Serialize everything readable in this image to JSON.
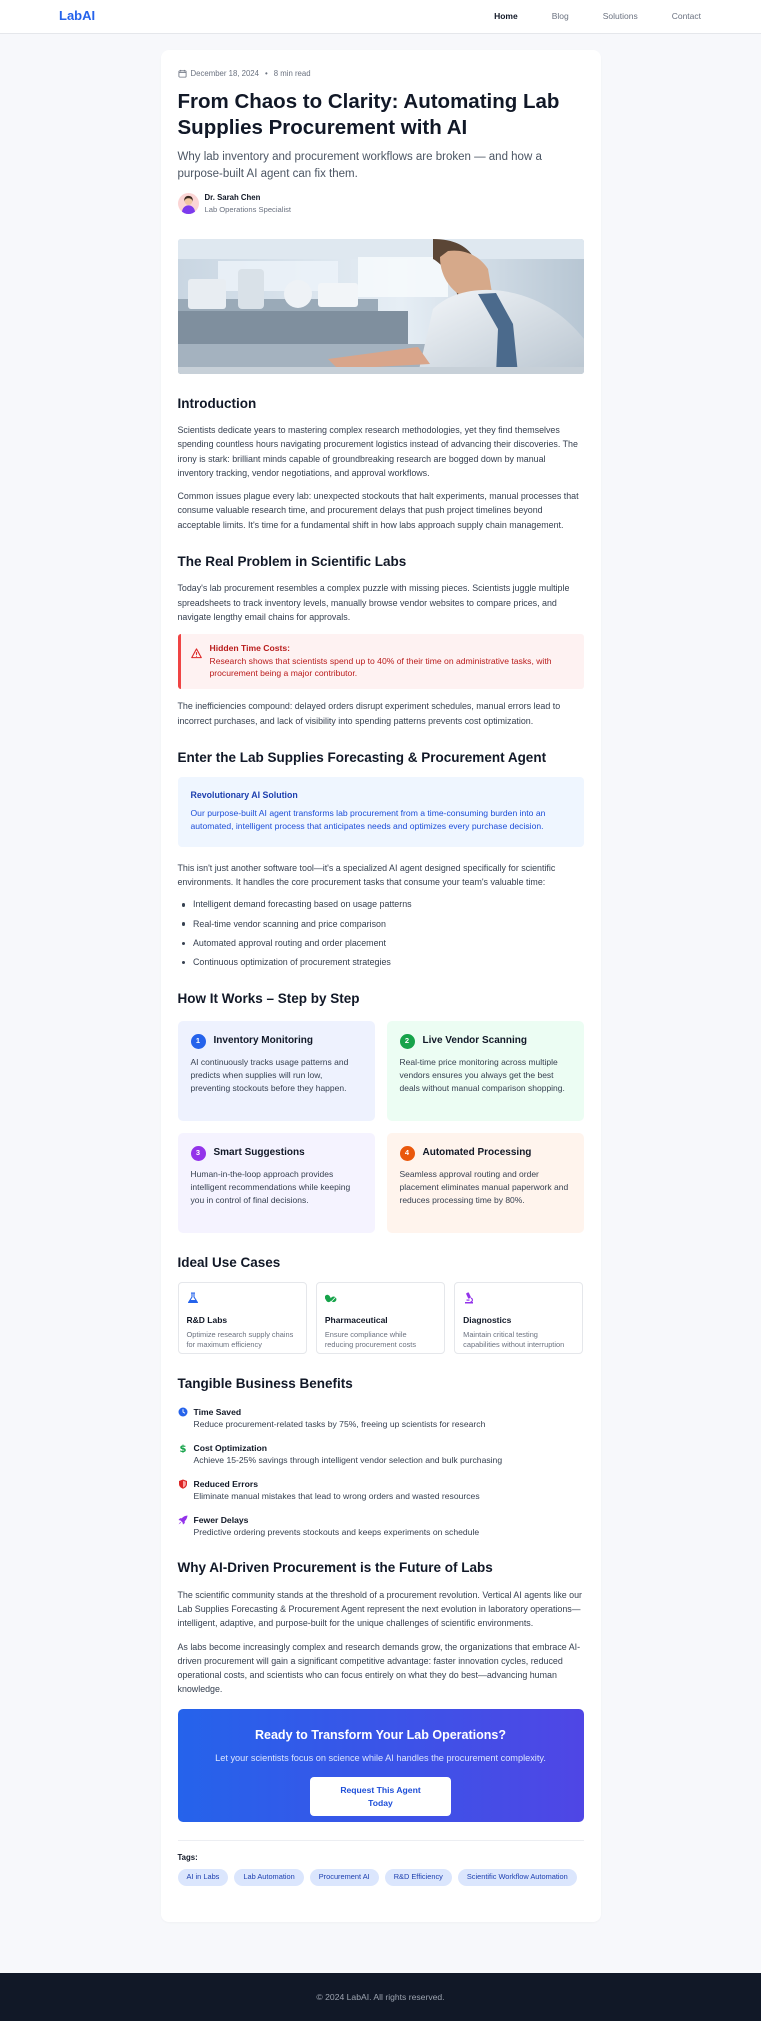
{
  "nav": {
    "brand": "LabAI",
    "links": [
      "Home",
      "Blog",
      "Solutions",
      "Contact"
    ]
  },
  "article": {
    "date": "December 18, 2024",
    "read_time": "8 min read",
    "title": "From Chaos to Clarity: Automating Lab Supplies Procurement with AI",
    "subtitle": "Why lab inventory and procurement workflows are broken — and how a purpose-built AI agent can fix them.",
    "author_name": "Dr. Sarah Chen",
    "author_role": "Lab Operations Specialist"
  },
  "intro": {
    "heading": "Introduction",
    "p1": "Scientists dedicate years to mastering complex research methodologies, yet they find themselves spending countless hours navigating procurement logistics instead of advancing their discoveries. The irony is stark: brilliant minds capable of groundbreaking research are bogged down by manual inventory tracking, vendor negotiations, and approval workflows.",
    "p2": "Common issues plague every lab: unexpected stockouts that halt experiments, manual processes that consume valuable research time, and procurement delays that push project timelines beyond acceptable limits. It's time for a fundamental shift in how labs approach supply chain management."
  },
  "problem": {
    "heading": "The Real Problem in Scientific Labs",
    "p1": "Today's lab procurement resembles a complex puzzle with missing pieces. Scientists juggle multiple spreadsheets to track inventory levels, manually browse vendor websites to compare prices, and navigate lengthy email chains for approvals.",
    "callout_title": "Hidden Time Costs:",
    "callout_body": "Research shows that scientists spend up to 40% of their time on administrative tasks, with procurement being a major contributor.",
    "p2": "The inefficiencies compound: delayed orders disrupt experiment schedules, manual errors lead to incorrect purchases, and lack of visibility into spending patterns prevents cost optimization."
  },
  "agent": {
    "heading": "Enter the Lab Supplies Forecasting & Procurement Agent",
    "callout_title": "Revolutionary AI Solution",
    "callout_body": "Our purpose-built AI agent transforms lab procurement from a time-consuming burden into an automated, intelligent process that anticipates needs and optimizes every purchase decision.",
    "p1": "This isn't just another software tool—it's a specialized AI agent designed specifically for scientific environments. It handles the core procurement tasks that consume your team's valuable time:",
    "bullets": [
      "Intelligent demand forecasting based on usage patterns",
      "Real-time vendor scanning and price comparison",
      "Automated approval routing and order placement",
      "Continuous optimization of procurement strategies"
    ]
  },
  "how": {
    "heading": "How It Works – Step by Step",
    "steps": [
      {
        "num": "1",
        "title": "Inventory Monitoring",
        "desc": "AI continuously tracks usage patterns and predicts when supplies will run low, preventing stockouts before they happen."
      },
      {
        "num": "2",
        "title": "Live Vendor Scanning",
        "desc": "Real-time price monitoring across multiple vendors ensures you always get the best deals without manual comparison shopping."
      },
      {
        "num": "3",
        "title": "Smart Suggestions",
        "desc": "Human-in-the-loop approach provides intelligent recommendations while keeping you in control of final decisions."
      },
      {
        "num": "4",
        "title": "Automated Processing",
        "desc": "Seamless approval routing and order placement eliminates manual paperwork and reduces processing time by 80%."
      }
    ]
  },
  "uses": {
    "heading": "Ideal Use Cases",
    "items": [
      {
        "icon": "flask-icon",
        "title": "R&D Labs",
        "desc": "Optimize research supply chains for maximum efficiency"
      },
      {
        "icon": "pills-icon",
        "title": "Pharmaceutical",
        "desc": "Ensure compliance while reducing procurement costs"
      },
      {
        "icon": "microscope-icon",
        "title": "Diagnostics",
        "desc": "Maintain critical testing capabilities without interruption"
      }
    ]
  },
  "benefits": {
    "heading": "Tangible Business Benefits",
    "items": [
      {
        "icon": "clock-icon",
        "title": "Time Saved",
        "desc": "Reduce procurement-related tasks by 75%, freeing up scientists for research"
      },
      {
        "icon": "dollar-icon",
        "title": "Cost Optimization",
        "desc": "Achieve 15-25% savings through intelligent vendor selection and bulk purchasing"
      },
      {
        "icon": "shield-icon",
        "title": "Reduced Errors",
        "desc": "Eliminate manual mistakes that lead to wrong orders and wasted resources"
      },
      {
        "icon": "rocket-icon",
        "title": "Fewer Delays",
        "desc": "Predictive ordering prevents stockouts and keeps experiments on schedule"
      }
    ]
  },
  "future": {
    "heading": "Why AI-Driven Procurement is the Future of Labs",
    "p1": "The scientific community stands at the threshold of a procurement revolution. Vertical AI agents like our Lab Supplies Forecasting & Procurement Agent represent the next evolution in laboratory operations—intelligent, adaptive, and purpose-built for the unique challenges of scientific environments.",
    "p2": "As labs become increasingly complex and research demands grow, the organizations that embrace AI-driven procurement will gain a significant competitive advantage: faster innovation cycles, reduced operational costs, and scientists who can focus entirely on what they do best—advancing human knowledge."
  },
  "cta": {
    "title": "Ready to Transform Your Lab Operations?",
    "desc": "Let your scientists focus on science while AI handles the procurement complexity.",
    "button": "Request This Agent Today"
  },
  "tags": {
    "label": "Tags:",
    "items": [
      "AI in Labs",
      "Lab Automation",
      "Procurement AI",
      "R&D Efficiency",
      "Scientific Workflow Automation"
    ]
  },
  "footer": {
    "text": "© 2024 LabAI. All rights reserved."
  },
  "colors": {
    "brand": "#2563eb",
    "footer_bg": "#111827",
    "cta_start": "#2563eb",
    "cta_end": "#4f46e5"
  }
}
